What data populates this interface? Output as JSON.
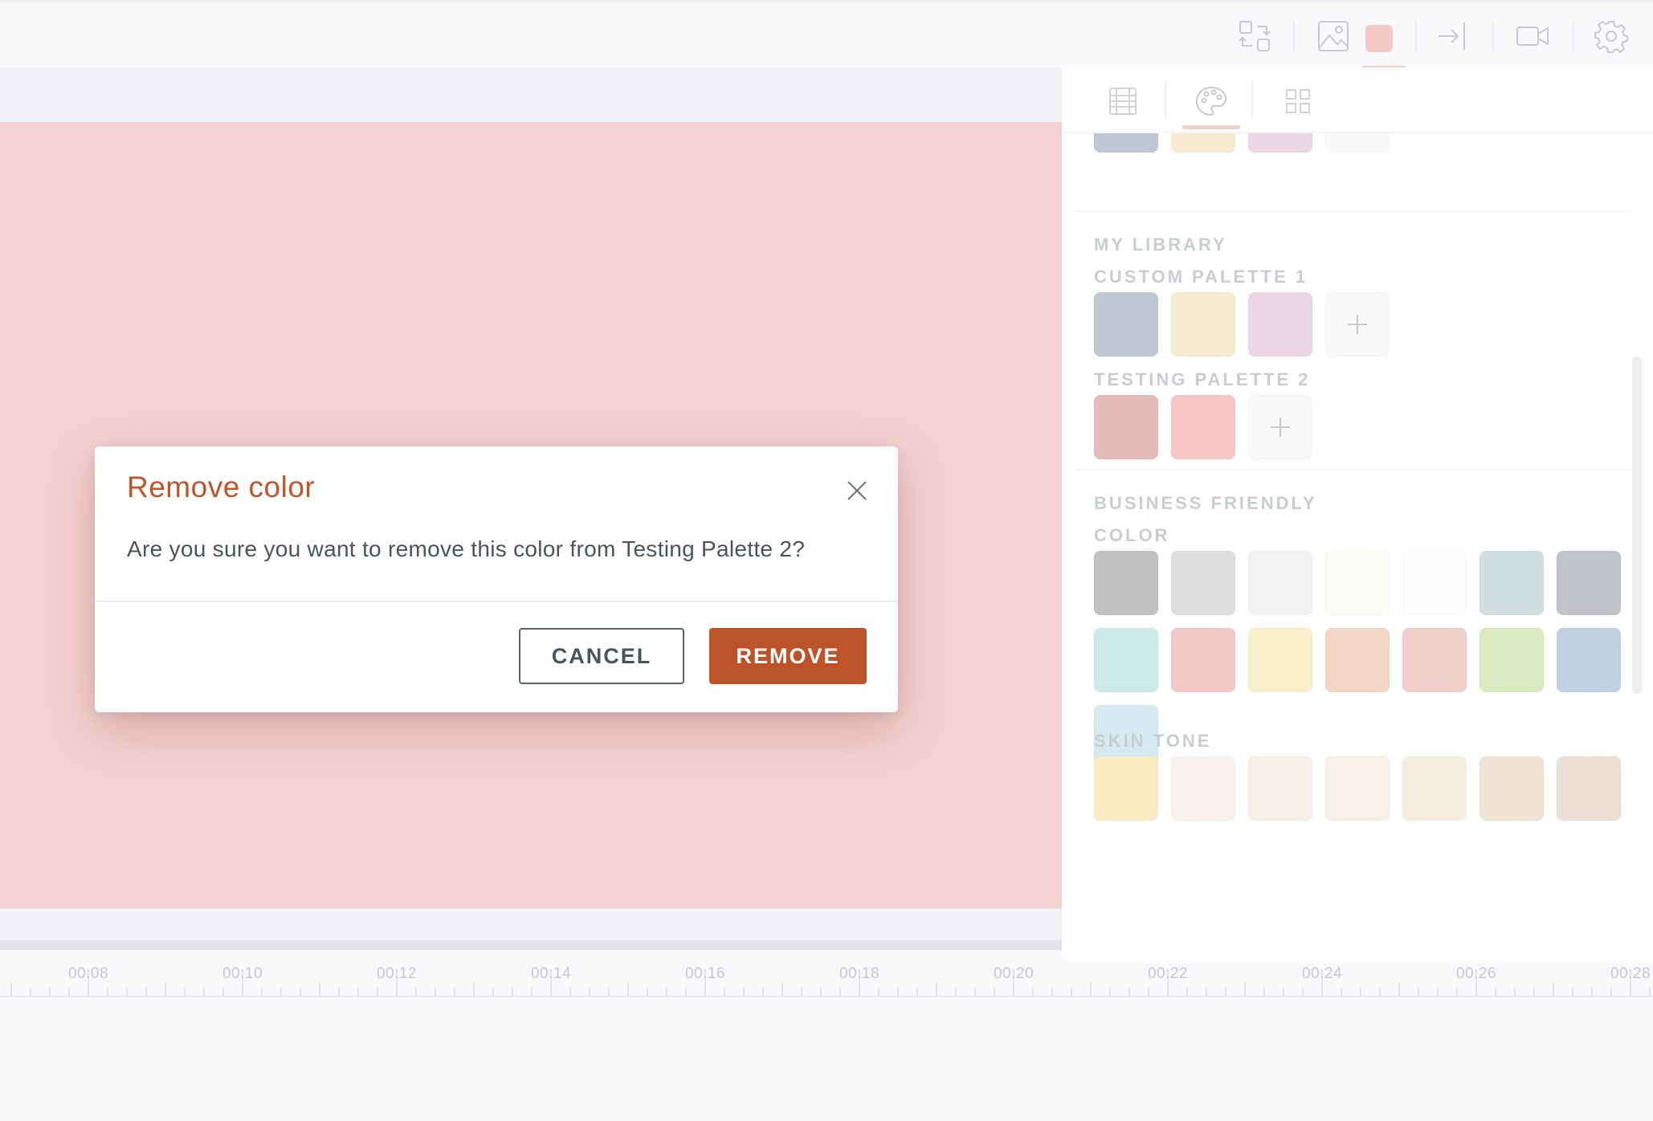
{
  "colors": {
    "canvas": "#f0b5b5",
    "accent": "#bd5429",
    "toolbar_swatch": "#f0a9a9"
  },
  "toolbar": {
    "icons": [
      "swap-icon",
      "image-icon",
      "color-swatch",
      "exit-icon",
      "video-camera-icon",
      "settings-gear-icon"
    ]
  },
  "panel": {
    "tabs": [
      "grid-frame-icon",
      "palette-icon",
      "layout-grid-icon"
    ],
    "top_partial_swatches": [
      "#9aa6bd",
      "#f3dfb3",
      "#dfbfcf"
    ],
    "my_library_label": "MY LIBRARY",
    "custom_palette_1": {
      "label": "CUSTOM PALETTE 1",
      "swatches": [
        "#9aa6bd",
        "#f3dfb3",
        "#dfbfcf"
      ]
    },
    "testing_palette_2": {
      "label": "TESTING PALETTE 2",
      "swatches": [
        "#d49090",
        "#eda5a1"
      ]
    },
    "business_friendly_label": "BUSINESS FRIENDLY",
    "color_label": "COLOR",
    "color_swatches": [
      "#9b9b9b",
      "#cbcbcb",
      "#ecebe8",
      "#fafaf0",
      "#fafafa",
      "#b5cccb",
      "#9aa0a5",
      "#afdede",
      "#eda5a5",
      "#f3e6a8",
      "#e8bf9e",
      "#e8b4b0",
      "#c6de9a",
      "#9ab6cf",
      "#bddbe8"
    ],
    "skin_tone_label": "SKIN TONE",
    "skin_tone_swatches": [
      "#f8e0a0",
      "#f6ebe6",
      "#f3e4d6",
      "#f3e8da",
      "#f3e2cc",
      "#e6d4ba",
      "#e2cbbd"
    ]
  },
  "timeline": {
    "labels": [
      "00:08",
      "00:10",
      "00:12",
      "00:14",
      "00:16",
      "00:18",
      "00:20",
      "00:22",
      "00:24",
      "00:26",
      "00:28"
    ]
  },
  "modal": {
    "title": "Remove color",
    "message": "Are you sure you want to remove this color from Testing Palette 2?",
    "cancel_label": "CANCEL",
    "remove_label": "REMOVE"
  }
}
